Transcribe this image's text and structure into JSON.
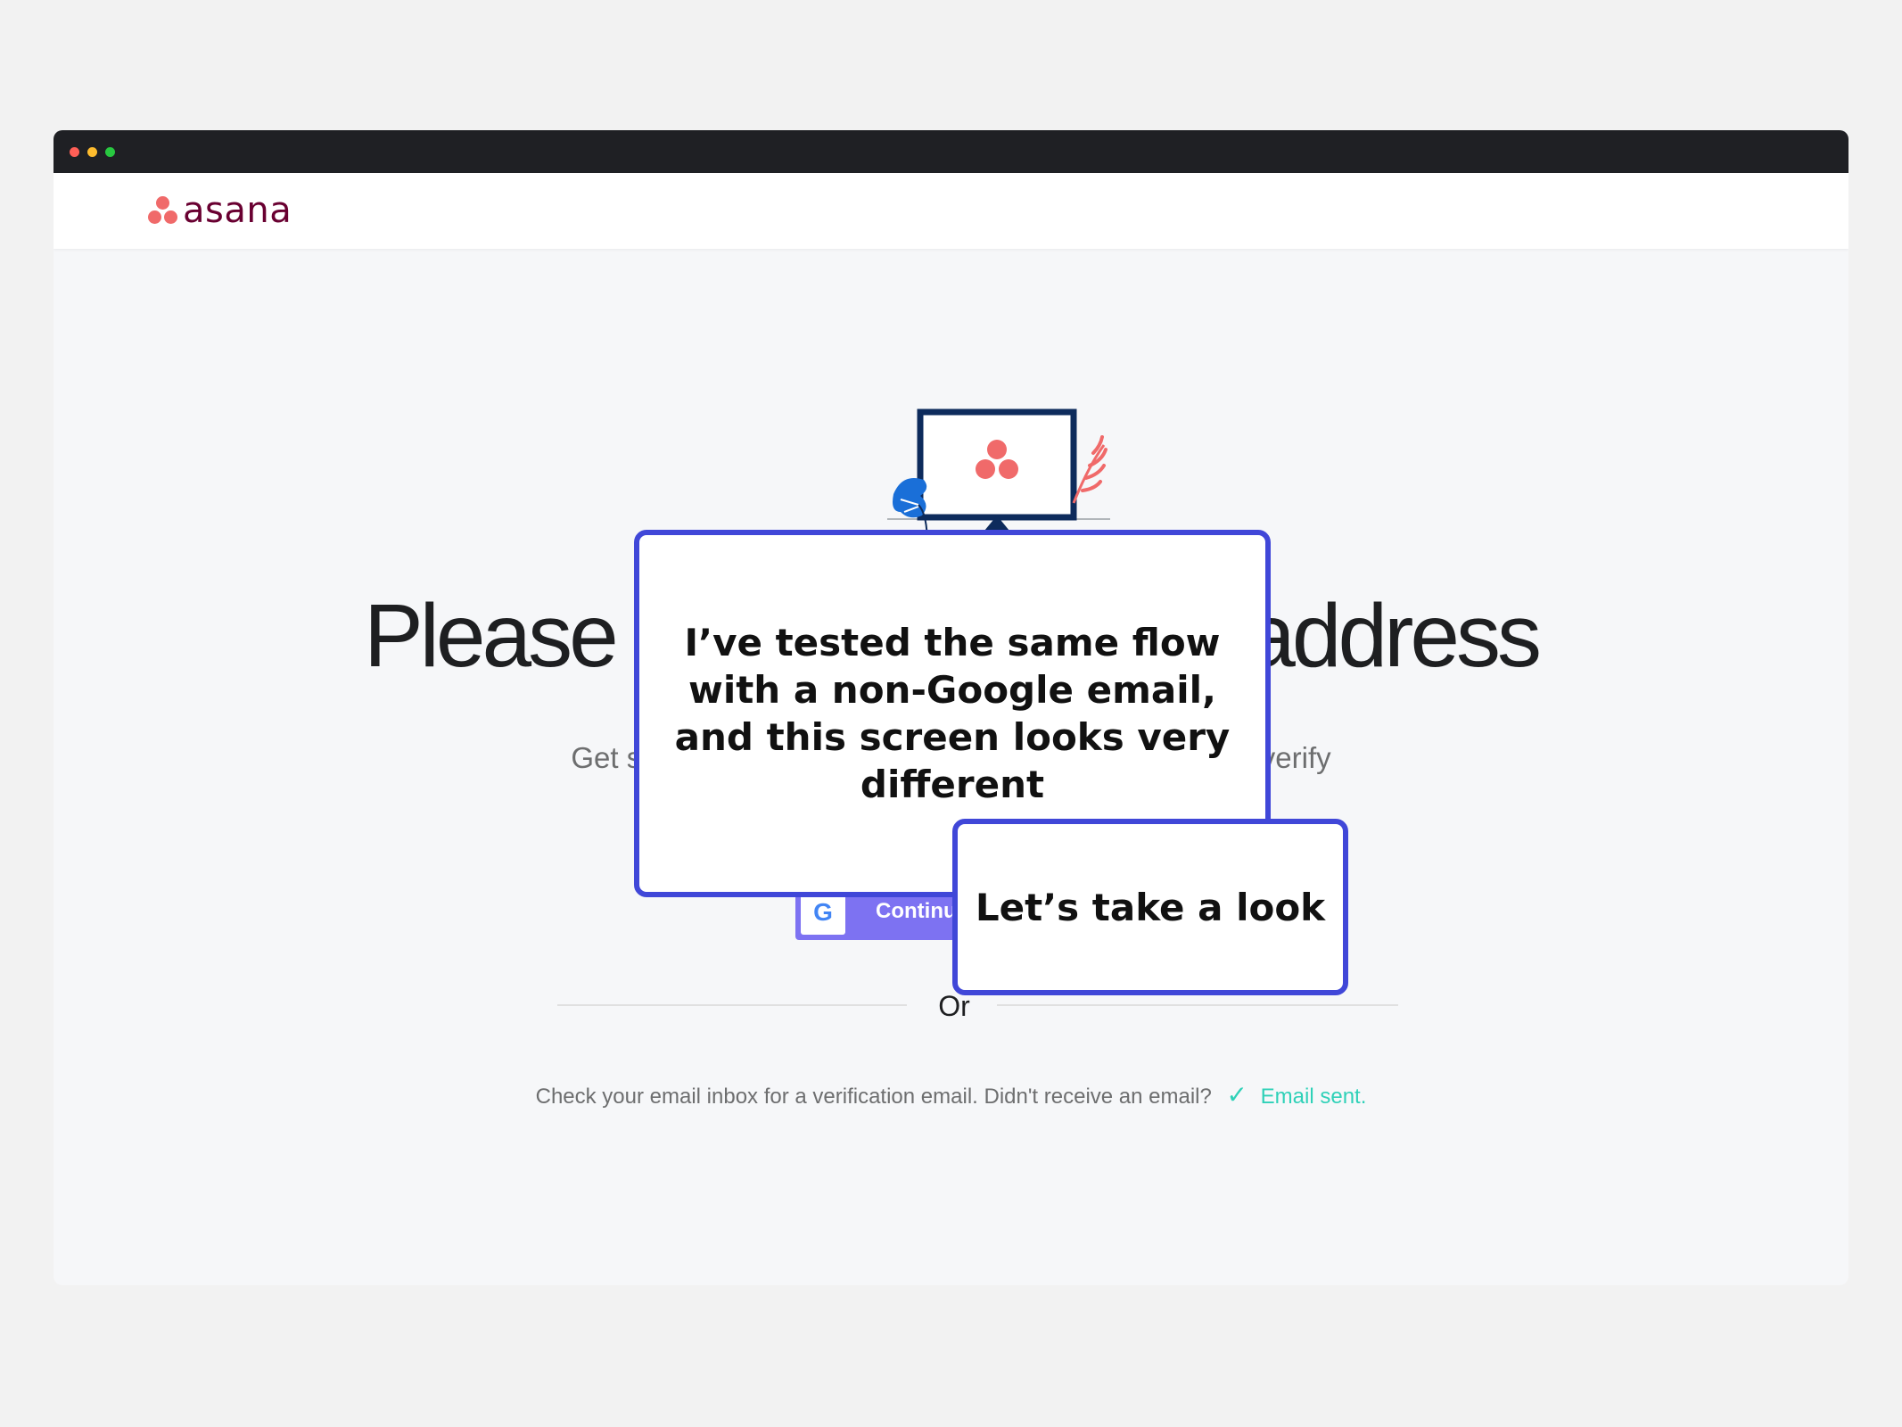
{
  "app": {
    "logo_text": "asana"
  },
  "page": {
    "heading": "Please verify your email address",
    "subtext": "Get started with Asana. We just sent you an email to verify",
    "google_button_label": "Continue with Google",
    "or_label": "Or",
    "notice_text": "Check your email inbox for a verification email. Didn't receive an email?",
    "email_sent_label": "Email sent.",
    "check_icon": "✓"
  },
  "callouts": {
    "main": "I’ve tested the same flow with a non-Google email, and this screen looks very different",
    "secondary": "Let’s take a look"
  },
  "colors": {
    "brand": "#f06a6a",
    "logo_text": "#690031",
    "button": "#7d72f2",
    "success": "#2fd1b8",
    "callout_border": "#4047d8"
  }
}
